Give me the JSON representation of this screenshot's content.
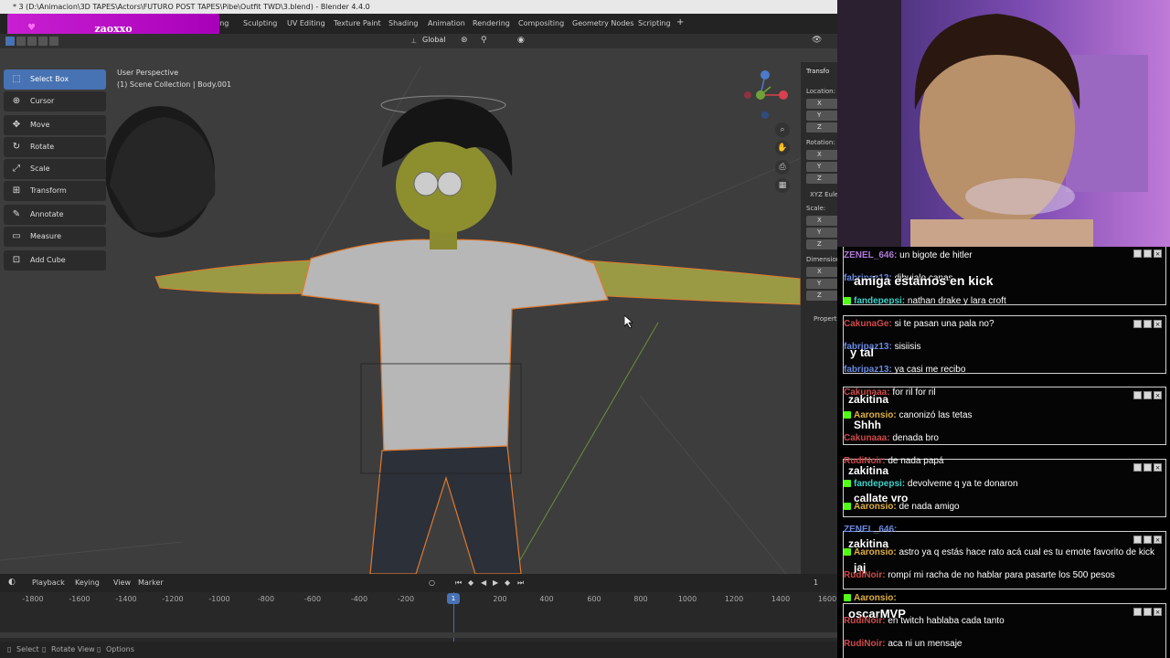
{
  "blender": {
    "title": "* 3 (D:\\Animacion\\3D TAPES\\Actors\\FUTURO POST TAPES\\Pibe\\Outfit TWD\\3.blend) - Blender 4.4.0",
    "streamer_name": "zaoxxo",
    "workspaces": [
      "ing",
      "Sculpting",
      "UV Editing",
      "Texture Paint",
      "Shading",
      "Animation",
      "Rendering",
      "Compositing",
      "Geometry Nodes",
      "Scripting"
    ],
    "add_workspace": "+",
    "orientation": "Global",
    "viewport_mode": "User Perspective",
    "collection_info": "(1) Scene Collection | Body.001",
    "tools": [
      {
        "label": "Select Box",
        "icon": "select-box-icon",
        "glyph": "⬚"
      },
      {
        "label": "Cursor",
        "icon": "cursor-icon",
        "glyph": "⊕"
      },
      {
        "label": "Move",
        "icon": "move-icon",
        "glyph": "✥"
      },
      {
        "label": "Rotate",
        "icon": "rotate-icon",
        "glyph": "↻"
      },
      {
        "label": "Scale",
        "icon": "scale-icon",
        "glyph": "⤢"
      },
      {
        "label": "Transform",
        "icon": "transform-icon",
        "glyph": "⊞"
      },
      {
        "label": "Annotate",
        "icon": "annotate-icon",
        "glyph": "✎"
      },
      {
        "label": "Measure",
        "icon": "measure-icon",
        "glyph": "📏"
      },
      {
        "label": "Add Cube",
        "icon": "add-cube-icon",
        "glyph": "⊡"
      }
    ],
    "npanel": {
      "tab": "Transfo",
      "location": "Location:",
      "rotation": "Rotation:",
      "mode": "XYZ Eule",
      "scale": "Scale:",
      "dimensions": "Dimension",
      "properties": "Properti",
      "axes": [
        "X",
        "Y",
        "Z"
      ]
    },
    "timeline": {
      "menus": [
        "Playback",
        "Keying",
        "View",
        "Marker"
      ],
      "current_frame": "1",
      "playhead_frame": "1",
      "ticks": [
        "-1800",
        "-1600",
        "-1400",
        "-1200",
        "-1000",
        "-800",
        "-600",
        "-400",
        "-200",
        "200",
        "400",
        "600",
        "800",
        "1000",
        "1200",
        "1400",
        "1600"
      ]
    },
    "status": [
      "Select",
      "Rotate View",
      "Options"
    ],
    "colors": {
      "accent": "#4772b3",
      "banner": "#c81fd2",
      "kick_green": "#53fc18"
    }
  },
  "chat": {
    "lines": [
      {
        "user": "ZENEL_646:",
        "text": " un bigote de hitler"
      },
      {
        "user": "fabripaz13:",
        "text": " dibujale canas"
      },
      {
        "user": "fandepepsi:",
        "text": " nathan drake y lara croft"
      },
      {
        "user": "CakunaGe:",
        "text": " si te pasan una pala no?"
      },
      {
        "user": "fabripaz13:",
        "text": " sisiisis"
      },
      {
        "user": "fabripaz13:",
        "text": " ya casi me recibo"
      },
      {
        "user": "Cakunaaa:",
        "text": " for ril for ril"
      },
      {
        "user": "Aaronsio:",
        "text": " canonizó las tetas"
      },
      {
        "user": "Cakunaaa:",
        "text": " denada bro"
      },
      {
        "user": "RudiNoir:",
        "text": " de nada papá"
      },
      {
        "user": "fandepepsi:",
        "text": " devolveme q ya te donaron"
      },
      {
        "user": "Aaronsio:",
        "text": " de nada amigo"
      },
      {
        "user": "ZENEL_646:",
        "text": ""
      },
      {
        "user": "Aaronsio:",
        "text": " astro ya q estás hace rato acá cual es tu emote favorito de kick"
      },
      {
        "user": "RudiNoir:",
        "text": " rompí mi racha de no hablar para pasarte los 500 pesos"
      },
      {
        "user": "Aaronsio:",
        "text": ""
      },
      {
        "user": "RudiNoir:",
        "text": " en twitch hablaba cada tanto"
      },
      {
        "user": "RudiNoir:",
        "text": " aca ni un mensaje"
      }
    ],
    "overlays": [
      "amiga estamos en kick",
      "y tal",
      "zakitina",
      "Shhh",
      "zakitina",
      "callate vro",
      "zakitina",
      "jaj",
      "oscarMVP"
    ]
  }
}
